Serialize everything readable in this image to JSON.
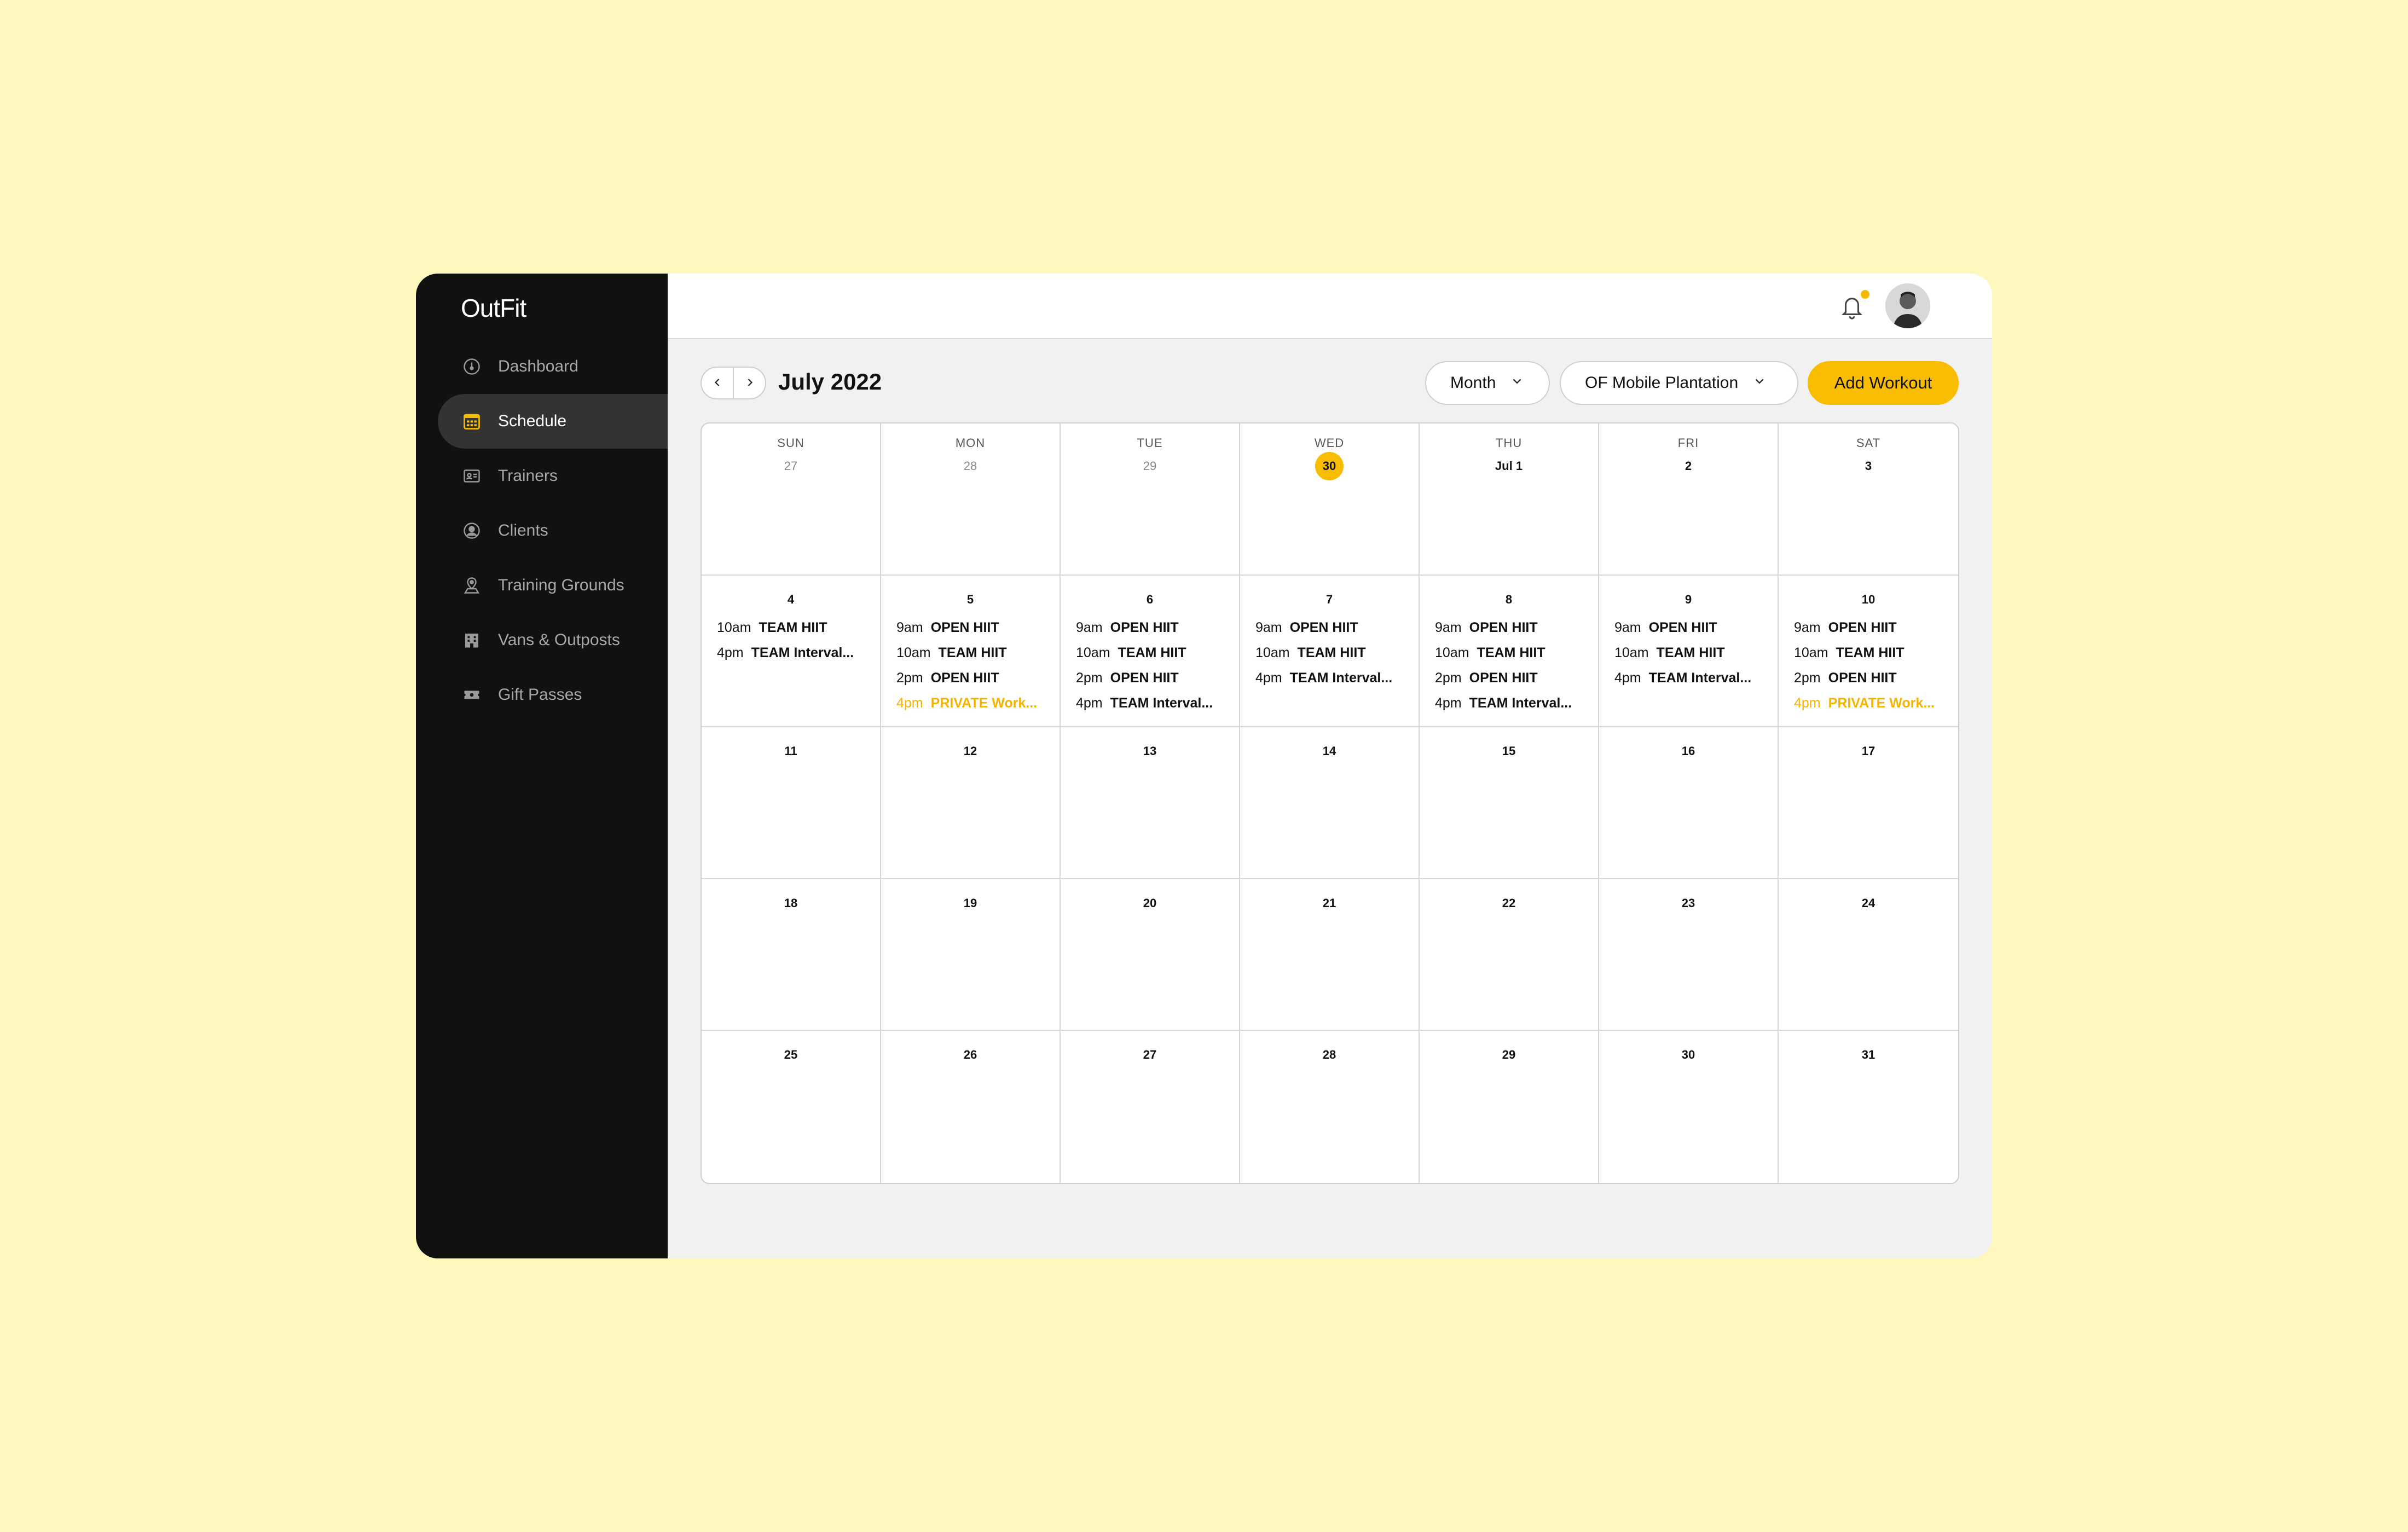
{
  "app": {
    "logo": "OutFit"
  },
  "colors": {
    "accent": "#F8BC00",
    "background": "#FEF7BE",
    "sidebar": "#111111"
  },
  "sidebar": {
    "items": [
      {
        "label": "Dashboard",
        "icon": "dashboard-icon",
        "active": false
      },
      {
        "label": "Schedule",
        "icon": "calendar-icon",
        "active": true
      },
      {
        "label": "Trainers",
        "icon": "id-card-icon",
        "active": false
      },
      {
        "label": "Clients",
        "icon": "user-circle-icon",
        "active": false
      },
      {
        "label": "Training Grounds",
        "icon": "map-pin-icon",
        "active": false
      },
      {
        "label": "Vans & Outposts",
        "icon": "building-icon",
        "active": false
      },
      {
        "label": "Gift Passes",
        "icon": "ticket-icon",
        "active": false
      }
    ]
  },
  "header": {
    "notification_icon": "bell-icon",
    "has_unread": true,
    "avatar": "user-avatar"
  },
  "toolbar": {
    "title": "July 2022",
    "view_select": "Month",
    "location_select": "OF Mobile Plantation",
    "add_button": "Add Workout"
  },
  "calendar": {
    "weekdays": [
      "SUN",
      "MON",
      "TUE",
      "WED",
      "THU",
      "FRI",
      "SAT"
    ],
    "days": [
      {
        "label": "27",
        "muted": true,
        "events": []
      },
      {
        "label": "28",
        "muted": true,
        "events": []
      },
      {
        "label": "29",
        "muted": true,
        "events": []
      },
      {
        "label": "30",
        "today": true,
        "events": []
      },
      {
        "label": "Jul 1",
        "events": []
      },
      {
        "label": "2",
        "events": []
      },
      {
        "label": "3",
        "events": []
      },
      {
        "label": "4",
        "events": [
          {
            "time": "10am",
            "name": "TEAM HIIT"
          },
          {
            "time": "4pm",
            "name": "TEAM Interval..."
          }
        ]
      },
      {
        "label": "5",
        "events": [
          {
            "time": "9am",
            "name": "OPEN HIIT"
          },
          {
            "time": "10am",
            "name": "TEAM HIIT"
          },
          {
            "time": "2pm",
            "name": "OPEN HIIT"
          },
          {
            "time": "4pm",
            "name": "PRIVATE Work...",
            "private": true
          }
        ]
      },
      {
        "label": "6",
        "events": [
          {
            "time": "9am",
            "name": "OPEN HIIT"
          },
          {
            "time": "10am",
            "name": "TEAM HIIT"
          },
          {
            "time": "2pm",
            "name": "OPEN HIIT"
          },
          {
            "time": "4pm",
            "name": "TEAM Interval..."
          }
        ]
      },
      {
        "label": "7",
        "events": [
          {
            "time": "9am",
            "name": "OPEN HIIT"
          },
          {
            "time": "10am",
            "name": "TEAM HIIT"
          },
          {
            "time": "4pm",
            "name": "TEAM Interval..."
          }
        ]
      },
      {
        "label": "8",
        "events": [
          {
            "time": "9am",
            "name": "OPEN HIIT"
          },
          {
            "time": "10am",
            "name": "TEAM HIIT"
          },
          {
            "time": "2pm",
            "name": "OPEN HIIT"
          },
          {
            "time": "4pm",
            "name": "TEAM Interval..."
          }
        ]
      },
      {
        "label": "9",
        "events": [
          {
            "time": "9am",
            "name": "OPEN HIIT"
          },
          {
            "time": "10am",
            "name": "TEAM HIIT"
          },
          {
            "time": "4pm",
            "name": "TEAM Interval..."
          }
        ]
      },
      {
        "label": "10",
        "events": [
          {
            "time": "9am",
            "name": "OPEN HIIT"
          },
          {
            "time": "10am",
            "name": "TEAM HIIT"
          },
          {
            "time": "2pm",
            "name": "OPEN HIIT"
          },
          {
            "time": "4pm",
            "name": "PRIVATE Work...",
            "private": true
          }
        ]
      },
      {
        "label": "11",
        "events": []
      },
      {
        "label": "12",
        "events": []
      },
      {
        "label": "13",
        "events": []
      },
      {
        "label": "14",
        "events": []
      },
      {
        "label": "15",
        "events": []
      },
      {
        "label": "16",
        "events": []
      },
      {
        "label": "17",
        "events": []
      },
      {
        "label": "18",
        "events": []
      },
      {
        "label": "19",
        "events": []
      },
      {
        "label": "20",
        "events": []
      },
      {
        "label": "21",
        "events": []
      },
      {
        "label": "22",
        "events": []
      },
      {
        "label": "23",
        "events": []
      },
      {
        "label": "24",
        "events": []
      },
      {
        "label": "25",
        "events": []
      },
      {
        "label": "26",
        "events": []
      },
      {
        "label": "27",
        "events": []
      },
      {
        "label": "28",
        "events": []
      },
      {
        "label": "29",
        "events": []
      },
      {
        "label": "30",
        "events": []
      },
      {
        "label": "31",
        "events": []
      }
    ]
  }
}
